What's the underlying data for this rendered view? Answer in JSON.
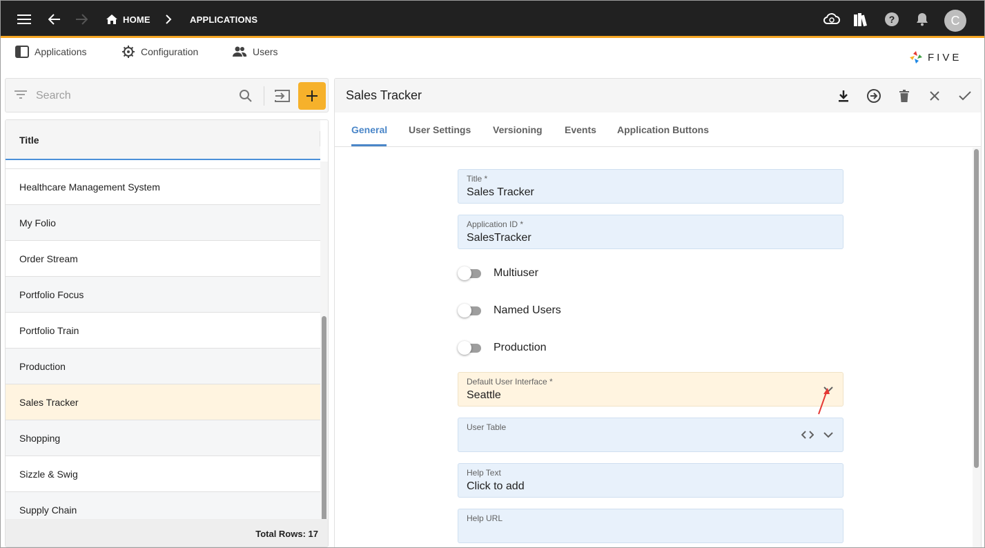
{
  "topbar": {
    "breadcrumbs": [
      "HOME",
      "APPLICATIONS"
    ],
    "avatar_initial": "C",
    "accent_color": "#f5a623"
  },
  "menu": {
    "items": [
      {
        "label": "Applications",
        "icon": "applications-icon"
      },
      {
        "label": "Configuration",
        "icon": "configuration-gear-icon"
      },
      {
        "label": "Users",
        "icon": "users-icon"
      }
    ],
    "logo_text": "FIVE"
  },
  "list": {
    "search_placeholder": "Search",
    "header": "Title",
    "rows": [
      "Healthcare Management System",
      "My Folio",
      "Order Stream",
      "Portfolio Focus",
      "Portfolio Train",
      "Production",
      "Sales Tracker",
      "Shopping",
      "Sizzle & Swig",
      "Supply Chain"
    ],
    "selected": "Sales Tracker",
    "total_rows": "Total Rows: 17"
  },
  "form": {
    "title": "Sales Tracker",
    "tabs": [
      "General",
      "User Settings",
      "Versioning",
      "Events",
      "Application Buttons"
    ],
    "active_tab": "General",
    "fields": {
      "title": {
        "label": "Title *",
        "value": "Sales Tracker"
      },
      "application_id": {
        "label": "Application ID *",
        "value": "SalesTracker"
      },
      "default_ui": {
        "label": "Default User Interface *",
        "value": "Seattle"
      },
      "user_table": {
        "label": "User Table",
        "value": ""
      },
      "help_text": {
        "label": "Help Text",
        "value": "Click to add"
      },
      "help_url": {
        "label": "Help URL",
        "value": ""
      }
    },
    "toggles": [
      {
        "label": "Multiuser",
        "on": false
      },
      {
        "label": "Named Users",
        "on": false
      },
      {
        "label": "Production",
        "on": false
      }
    ]
  },
  "colors": {
    "primary_blue": "#4a86c8",
    "add_button": "#f6b12b",
    "field_bg": "#e8f1fb",
    "selected_row": "#fff4e0",
    "annotation_arrow": "#e53935"
  }
}
